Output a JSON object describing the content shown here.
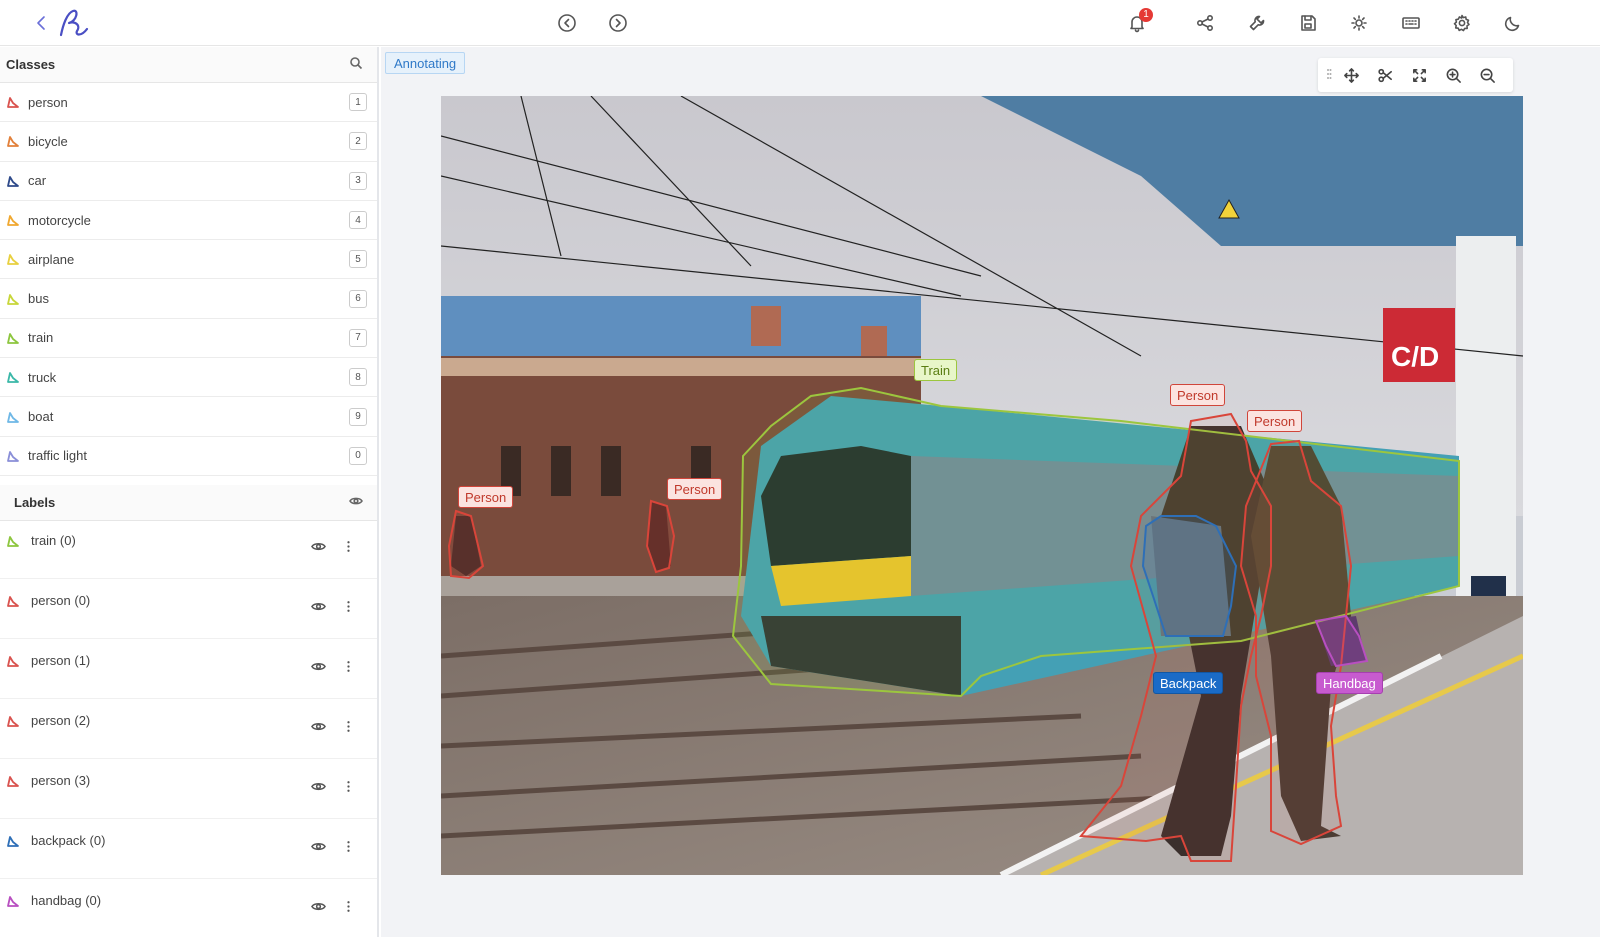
{
  "toolbar": {
    "notification_count": "1",
    "icons": [
      "back-icon",
      "logo-icon",
      "prev-image-icon",
      "next-image-icon",
      "bell-icon",
      "share-icon",
      "wrench-icon",
      "save-icon",
      "brightness-icon",
      "keyboard-icon",
      "settings-icon",
      "dark-mode-icon"
    ]
  },
  "classes": {
    "title": "Classes",
    "items": [
      {
        "name": "person",
        "key": "1",
        "color": "#d9534f"
      },
      {
        "name": "bicycle",
        "key": "2",
        "color": "#e2803a"
      },
      {
        "name": "car",
        "key": "3",
        "color": "#2e4a8a"
      },
      {
        "name": "motorcycle",
        "key": "4",
        "color": "#f0a830"
      },
      {
        "name": "airplane",
        "key": "5",
        "color": "#e8d040"
      },
      {
        "name": "bus",
        "key": "6",
        "color": "#c8d63a"
      },
      {
        "name": "train",
        "key": "7",
        "color": "#8dc63f"
      },
      {
        "name": "truck",
        "key": "8",
        "color": "#3bb8a8"
      },
      {
        "name": "boat",
        "key": "9",
        "color": "#6fb8e6"
      },
      {
        "name": "traffic light",
        "key": "0",
        "color": "#8a8fd8"
      }
    ]
  },
  "labels": {
    "title": "Labels",
    "items": [
      {
        "name": "train (0)",
        "color": "#8dc63f"
      },
      {
        "name": "person (0)",
        "color": "#d9534f"
      },
      {
        "name": "person (1)",
        "color": "#d9534f"
      },
      {
        "name": "person (2)",
        "color": "#d9534f"
      },
      {
        "name": "person (3)",
        "color": "#d9534f"
      },
      {
        "name": "backpack (0)",
        "color": "#2e6fb7"
      },
      {
        "name": "handbag (0)",
        "color": "#b84fc0"
      }
    ]
  },
  "canvas": {
    "status": "Annotating",
    "tags": {
      "person": "Person",
      "train": "Train",
      "backpack": "Backpack",
      "handbag": "Handbag"
    },
    "sign_text": "C/D"
  }
}
